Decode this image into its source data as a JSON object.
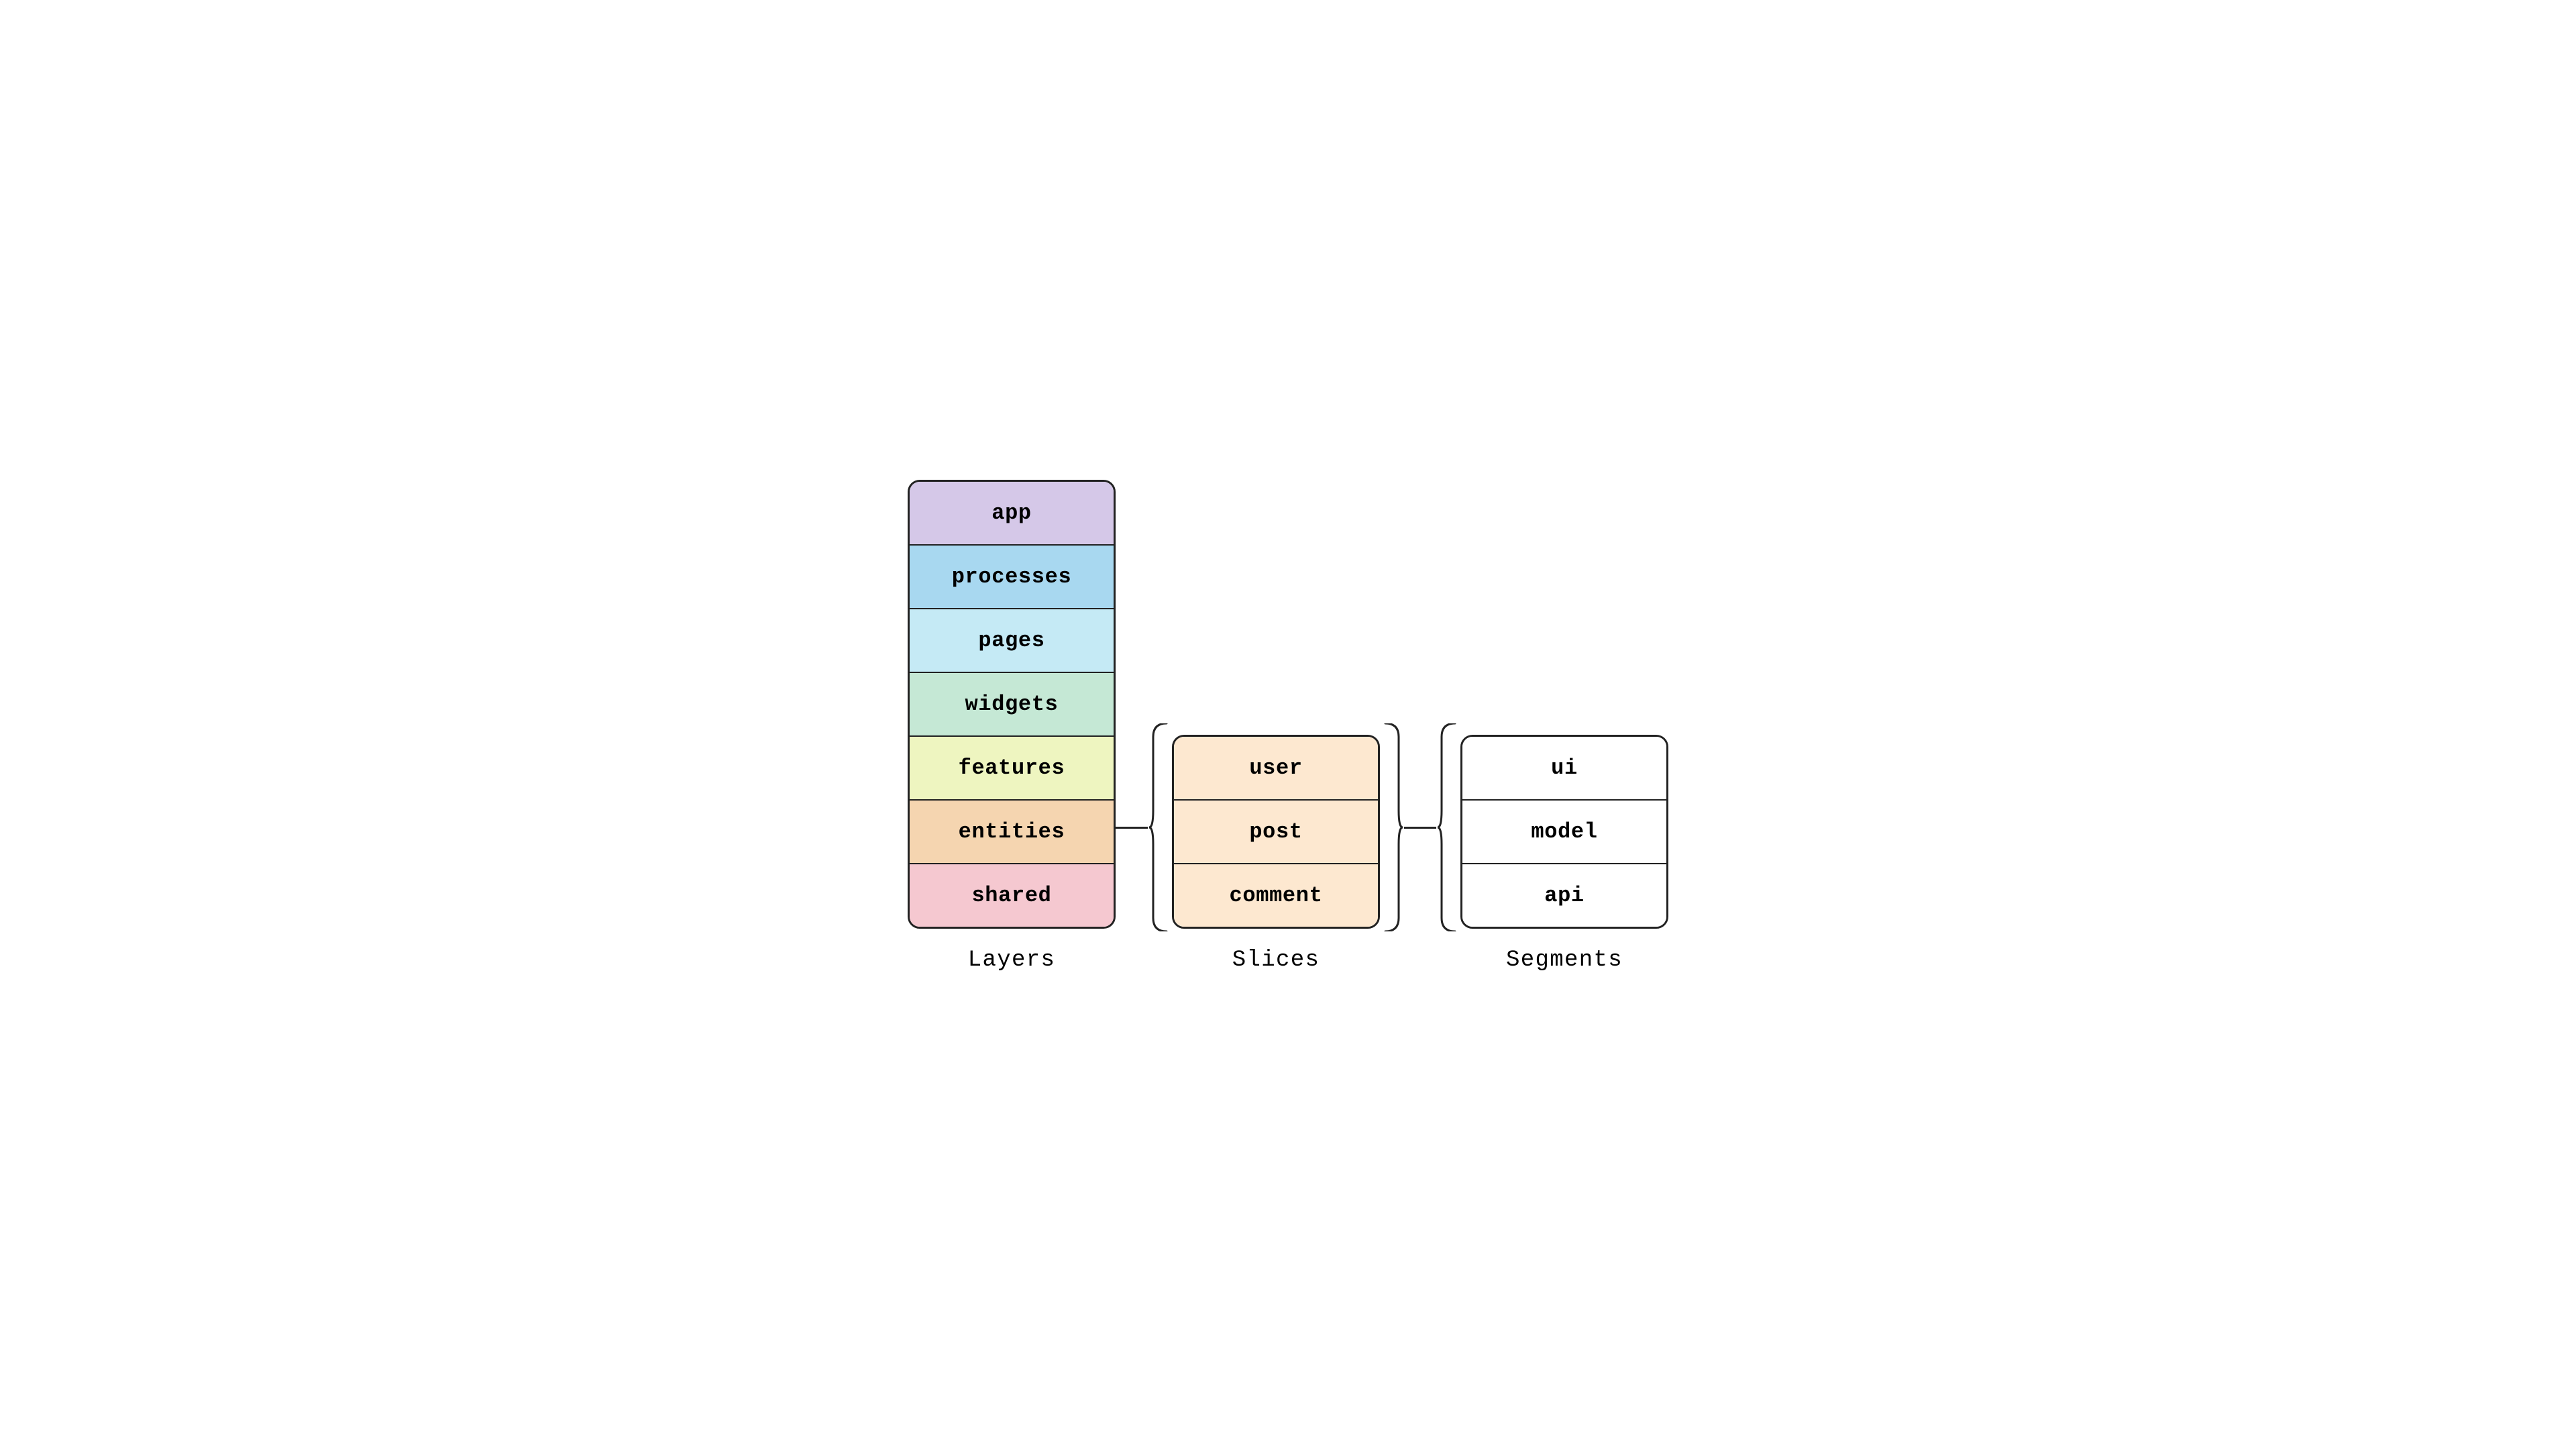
{
  "layers": {
    "label": "Layers",
    "items": [
      {
        "name": "app",
        "class": "layer-app"
      },
      {
        "name": "processes",
        "class": "layer-processes"
      },
      {
        "name": "pages",
        "class": "layer-pages"
      },
      {
        "name": "widgets",
        "class": "layer-widgets"
      },
      {
        "name": "features",
        "class": "layer-features"
      },
      {
        "name": "entities",
        "class": "layer-entities"
      },
      {
        "name": "shared",
        "class": "layer-shared"
      }
    ]
  },
  "slices": {
    "label": "Slices",
    "items": [
      {
        "name": "user"
      },
      {
        "name": "post"
      },
      {
        "name": "comment"
      }
    ]
  },
  "segments": {
    "label": "Segments",
    "items": [
      {
        "name": "ui"
      },
      {
        "name": "model"
      },
      {
        "name": "api"
      }
    ]
  }
}
